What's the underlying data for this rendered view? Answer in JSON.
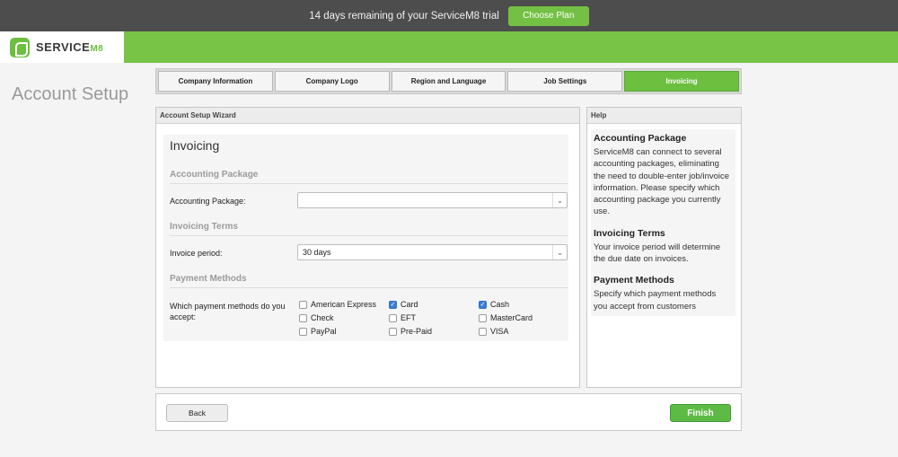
{
  "trial_bar": {
    "message": "14 days remaining of your ServiceM8 trial",
    "button_label": "Choose Plan"
  },
  "header": {
    "logo_text": "SERVICE",
    "logo_suffix": "M8"
  },
  "page_title": "Account Setup",
  "tabs": [
    {
      "label": "Company Information",
      "active": false
    },
    {
      "label": "Company Logo",
      "active": false
    },
    {
      "label": "Region and Language",
      "active": false
    },
    {
      "label": "Job Settings",
      "active": false
    },
    {
      "label": "Invoicing",
      "active": true
    }
  ],
  "wizard": {
    "header": "Account Setup Wizard",
    "section_title": "Invoicing",
    "accounting": {
      "group_title": "Accounting Package",
      "label": "Accounting Package:",
      "value": ""
    },
    "terms": {
      "group_title": "Invoicing Terms",
      "label": "Invoice period:",
      "value": "30 days"
    },
    "payment": {
      "group_title": "Payment Methods",
      "question": "Which payment methods do you accept:",
      "methods": [
        {
          "label": "American Express",
          "checked": false
        },
        {
          "label": "Card",
          "checked": true
        },
        {
          "label": "Cash",
          "checked": true
        },
        {
          "label": "Check",
          "checked": false
        },
        {
          "label": "EFT",
          "checked": false
        },
        {
          "label": "MasterCard",
          "checked": false
        },
        {
          "label": "PayPal",
          "checked": false
        },
        {
          "label": "Pre-Paid",
          "checked": false
        },
        {
          "label": "VISA",
          "checked": false
        }
      ]
    }
  },
  "help": {
    "header": "Help",
    "sections": [
      {
        "title": "Accounting Package",
        "text": "ServiceM8 can connect to several accounting packages, eliminating the need to double-enter job/invoice information. Please specify which accounting package you currently use."
      },
      {
        "title": "Invoicing Terms",
        "text": "Your invoice period will determine the due date on invoices."
      },
      {
        "title": "Payment Methods",
        "text": "Specify which payment methods you accept from customers"
      }
    ]
  },
  "footer": {
    "back_label": "Back",
    "finish_label": "Finish"
  },
  "colors": {
    "brand_green": "#77c447",
    "trial_bar": "#4d4d4d",
    "checkbox_checked": "#3b82d6"
  }
}
